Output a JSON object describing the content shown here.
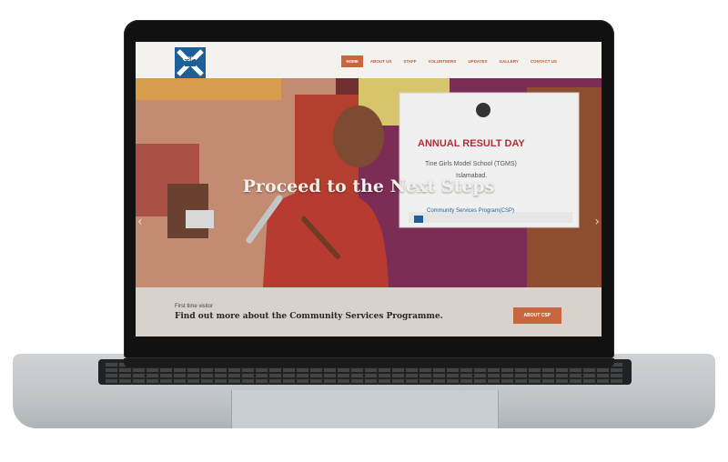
{
  "site": {
    "logo_text": "CSP",
    "nav": [
      "HOME",
      "ABOUT US",
      "STAFF",
      "VOLUNTEERS",
      "UPDATES",
      "GALLERY",
      "CONTACT US"
    ],
    "active_nav": "HOME"
  },
  "hero": {
    "title": "Proceed to the Next Steps",
    "banner": {
      "line1": "ANNUAL RESULT DAY",
      "line2": "Tine Girls Model School (TGMS)",
      "line3": "Islamabad.",
      "line4": "Community Services Program(CSP)"
    },
    "left_arrow": "‹",
    "right_arrow": "›"
  },
  "panel": {
    "kicker": "First time visitor",
    "title": "Find out more about the Community Services Programme.",
    "button": "ABOUT CSP"
  },
  "colors": {
    "accent": "#c9663d",
    "logo_blue": "#1d5f98"
  }
}
